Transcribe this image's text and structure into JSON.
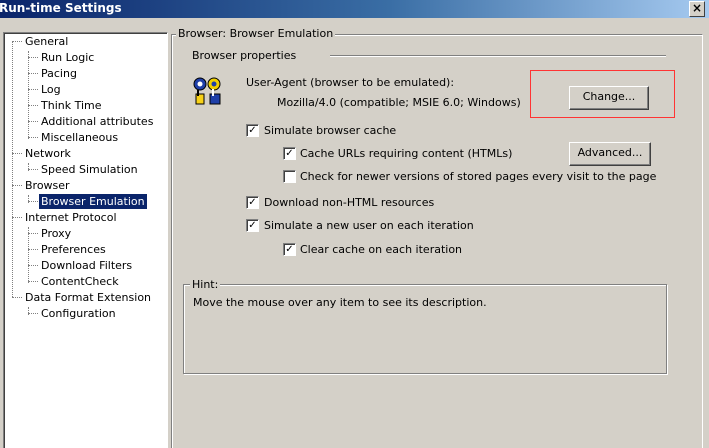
{
  "window": {
    "title": "Run-time Settings",
    "close_glyph": "×"
  },
  "tree": {
    "items": [
      {
        "label": "General",
        "level": 0
      },
      {
        "label": "Run Logic",
        "level": 1
      },
      {
        "label": "Pacing",
        "level": 1
      },
      {
        "label": "Log",
        "level": 1
      },
      {
        "label": "Think Time",
        "level": 1
      },
      {
        "label": "Additional attributes",
        "level": 1
      },
      {
        "label": "Miscellaneous",
        "level": 1
      },
      {
        "label": "Network",
        "level": 0
      },
      {
        "label": "Speed Simulation",
        "level": 1
      },
      {
        "label": "Browser",
        "level": 0
      },
      {
        "label": "Browser Emulation",
        "level": 1,
        "selected": true
      },
      {
        "label": "Internet Protocol",
        "level": 0
      },
      {
        "label": "Proxy",
        "level": 1
      },
      {
        "label": "Preferences",
        "level": 1
      },
      {
        "label": "Download Filters",
        "level": 1
      },
      {
        "label": "ContentCheck",
        "level": 1
      },
      {
        "label": "Data Format Extension",
        "level": 0
      },
      {
        "label": "Configuration",
        "level": 1
      }
    ]
  },
  "panel": {
    "title": "Browser: Browser Emulation",
    "section_label": "Browser properties",
    "user_agent_label": "User-Agent (browser to be emulated):",
    "user_agent_value": "Mozilla/4.0 (compatible; MSIE 6.0; Windows)",
    "change_button": "Change...",
    "advanced_button": "Advanced...",
    "options": {
      "simulate_cache": {
        "label": "Simulate browser cache",
        "checked": true
      },
      "cache_urls": {
        "label": "Cache URLs requiring content (HTMLs)",
        "checked": true
      },
      "check_newer": {
        "label": "Check for newer versions of stored pages every visit to the page",
        "checked": false
      },
      "download_non_html": {
        "label": "Download non-HTML resources",
        "checked": true
      },
      "new_user": {
        "label": "Simulate a new user on each iteration",
        "checked": true
      },
      "clear_cache": {
        "label": "Clear cache on each iteration",
        "checked": true
      }
    },
    "check_glyph": "✓"
  },
  "hint": {
    "title": "Hint:",
    "text": "Move the mouse over any item to see its description."
  },
  "colors": {
    "title_bar": "#0a246a",
    "selection": "#0a246a",
    "highlight_box": "#ff3333",
    "face": "#d4d0c8"
  }
}
